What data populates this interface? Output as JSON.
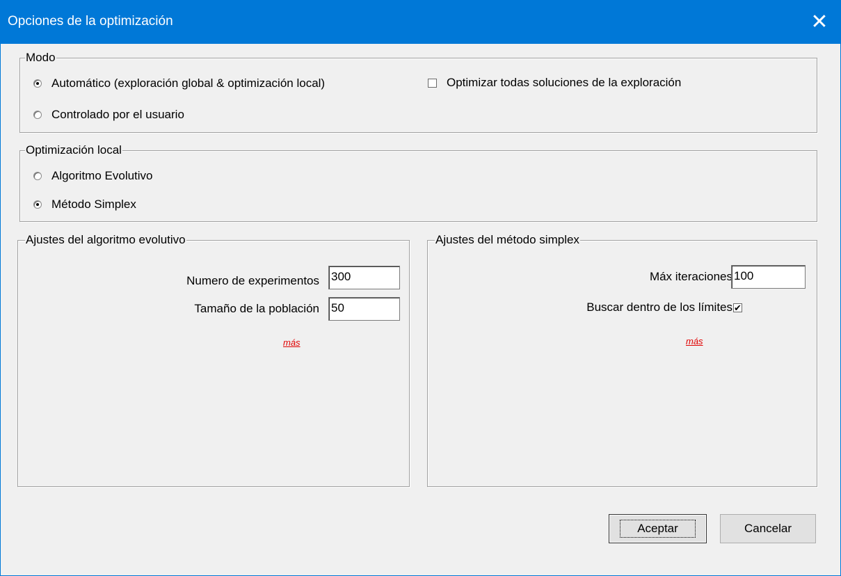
{
  "window": {
    "title": "Opciones de la optimización",
    "close_glyph": "✕"
  },
  "modo": {
    "legend": "Modo",
    "auto_label": "Automático (exploración global & optimización local)",
    "auto_selected": true,
    "user_label": "Controlado por el usuario",
    "user_selected": false,
    "optimize_all_label": "Optimizar todas soluciones de la exploración",
    "optimize_all_checked": false
  },
  "local": {
    "legend": "Optimización local",
    "evolutive_label": "Algoritmo Evolutivo",
    "evolutive_selected": false,
    "simplex_label": "Método Simplex",
    "simplex_selected": true
  },
  "evo": {
    "legend": "Ajustes del algoritmo evolutivo",
    "experiments_label": "Numero de experimentos",
    "experiments_value": "300",
    "population_label": "Tamaño de la población",
    "population_value": "50",
    "more_link": "más"
  },
  "simplex": {
    "legend": "Ajustes del método simplex",
    "max_iter_label": "Máx iteraciones",
    "max_iter_value": "100",
    "bounds_label": "Buscar dentro de los límites",
    "bounds_checked": true,
    "check_glyph": "✔",
    "more_link": "más"
  },
  "buttons": {
    "accept": "Aceptar",
    "cancel": "Cancelar"
  }
}
